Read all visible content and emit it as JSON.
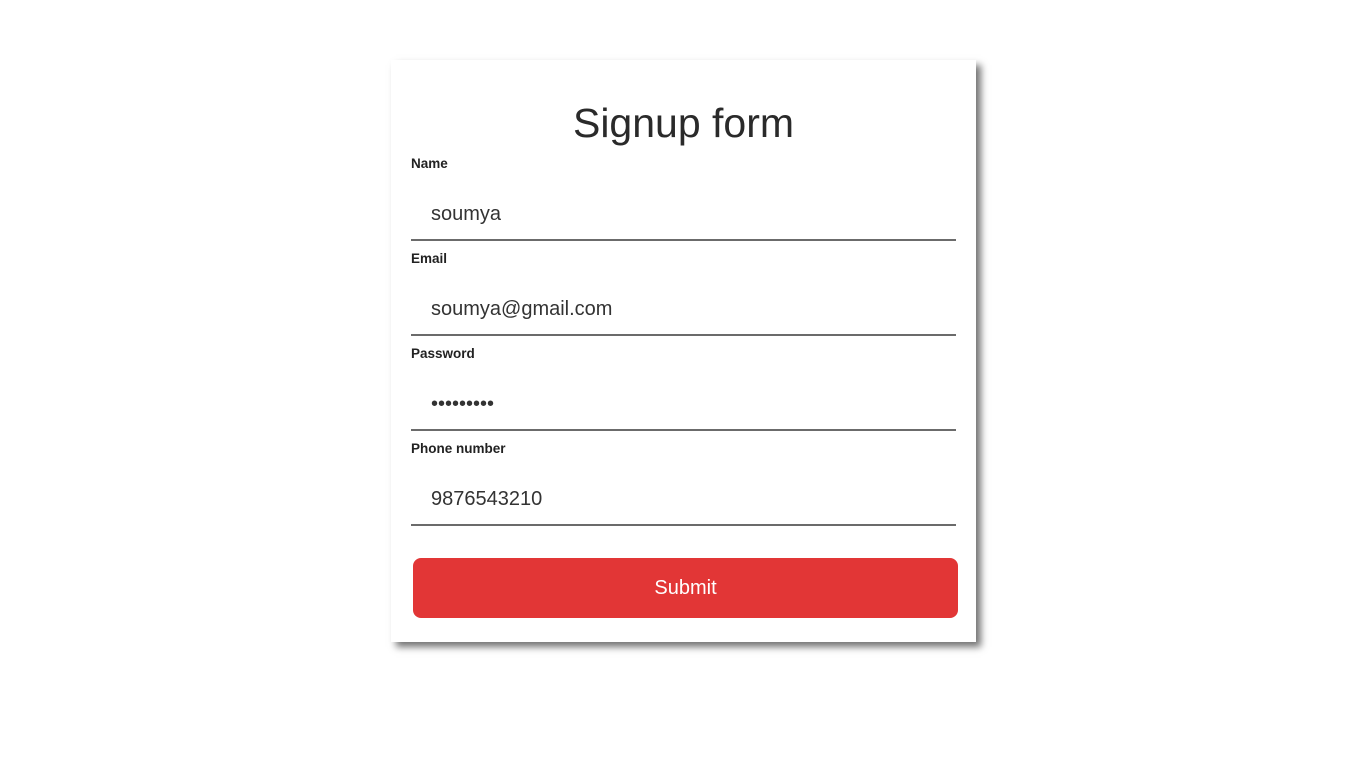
{
  "form": {
    "title": "Signup form",
    "fields": [
      {
        "label": "Name",
        "value": "soumya",
        "type": "text"
      },
      {
        "label": "Email",
        "value": "soumya@gmail.com",
        "type": "email"
      },
      {
        "label": "Password",
        "value": "•••••••••",
        "type": "password"
      },
      {
        "label": "Phone number",
        "value": "9876543210",
        "type": "tel"
      }
    ],
    "submit_label": "Submit"
  },
  "colors": {
    "submit_button": "#e23636",
    "input_underline": "#6b6b6b",
    "text": "#2a2a2a"
  }
}
